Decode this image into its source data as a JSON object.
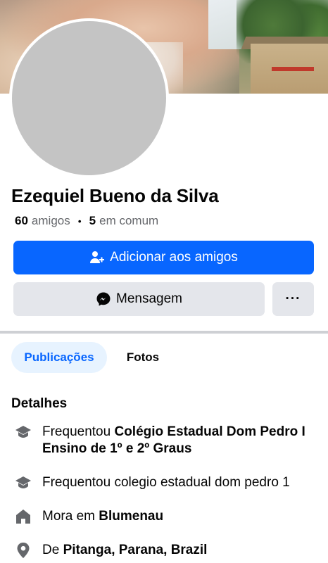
{
  "profile": {
    "name": "Ezequiel Bueno da Silva",
    "friends_count": "60",
    "friends_label": "amigos",
    "mutual_count": "5",
    "mutual_label": "em comum"
  },
  "actions": {
    "add_friend_label": "Adicionar aos amigos",
    "message_label": "Mensagem",
    "more_label": "···"
  },
  "tabs": [
    {
      "label": "Publicações",
      "active": true
    },
    {
      "label": "Fotos",
      "active": false
    }
  ],
  "details": {
    "title": "Detalhes",
    "items": [
      {
        "icon": "education-icon",
        "prefix": "Frequentou ",
        "bold": "Colégio Estadual Dom Pedro I Ensino de 1º e 2º Graus"
      },
      {
        "icon": "education-icon",
        "prefix": "Frequentou colegio estadual dom pedro 1",
        "bold": ""
      },
      {
        "icon": "home-icon",
        "prefix": "Mora em ",
        "bold": "Blumenau"
      },
      {
        "icon": "location-pin-icon",
        "prefix": "De ",
        "bold": "Pitanga, Parana, Brazil"
      }
    ]
  },
  "colors": {
    "primary": "#0866ff",
    "secondary_button": "#e4e6eb",
    "tab_active_bg": "#e7f3ff",
    "muted_text": "#65676b"
  }
}
